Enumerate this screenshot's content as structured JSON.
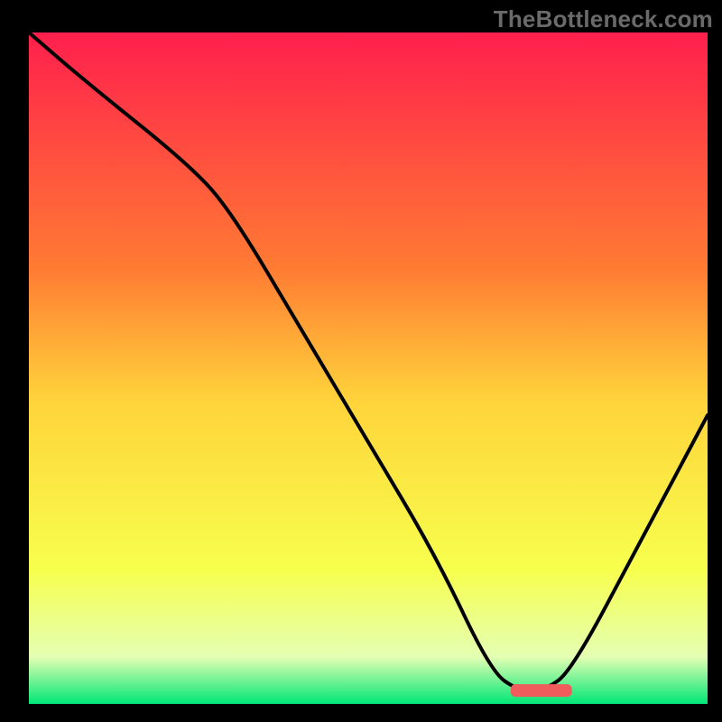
{
  "watermark": "TheBottleneck.com",
  "chart_data": {
    "type": "line",
    "title": "",
    "xlabel": "",
    "ylabel": "",
    "xlim": [
      0,
      100
    ],
    "ylim": [
      0,
      100
    ],
    "grid": false,
    "series": [
      {
        "name": "curve",
        "x": [
          0,
          8,
          24,
          30,
          40,
          50,
          60,
          68,
          72,
          76,
          80,
          90,
          100
        ],
        "values": [
          100,
          93,
          80,
          73,
          56,
          39,
          22,
          5,
          2,
          2,
          5,
          24,
          43
        ]
      }
    ],
    "highlight_segment": {
      "x_from": 71,
      "x_to": 80,
      "y": 2
    },
    "colors": {
      "curve": "#000000",
      "highlight": "#f05b5b",
      "gradient_top": "#ff1f4d",
      "gradient_upper_mid": "#ff7b33",
      "gradient_mid": "#ffd43b",
      "gradient_lower_mid": "#f7ff4d",
      "gradient_bottom_light": "#e4ffb3",
      "gradient_bottom": "#00e676"
    }
  }
}
